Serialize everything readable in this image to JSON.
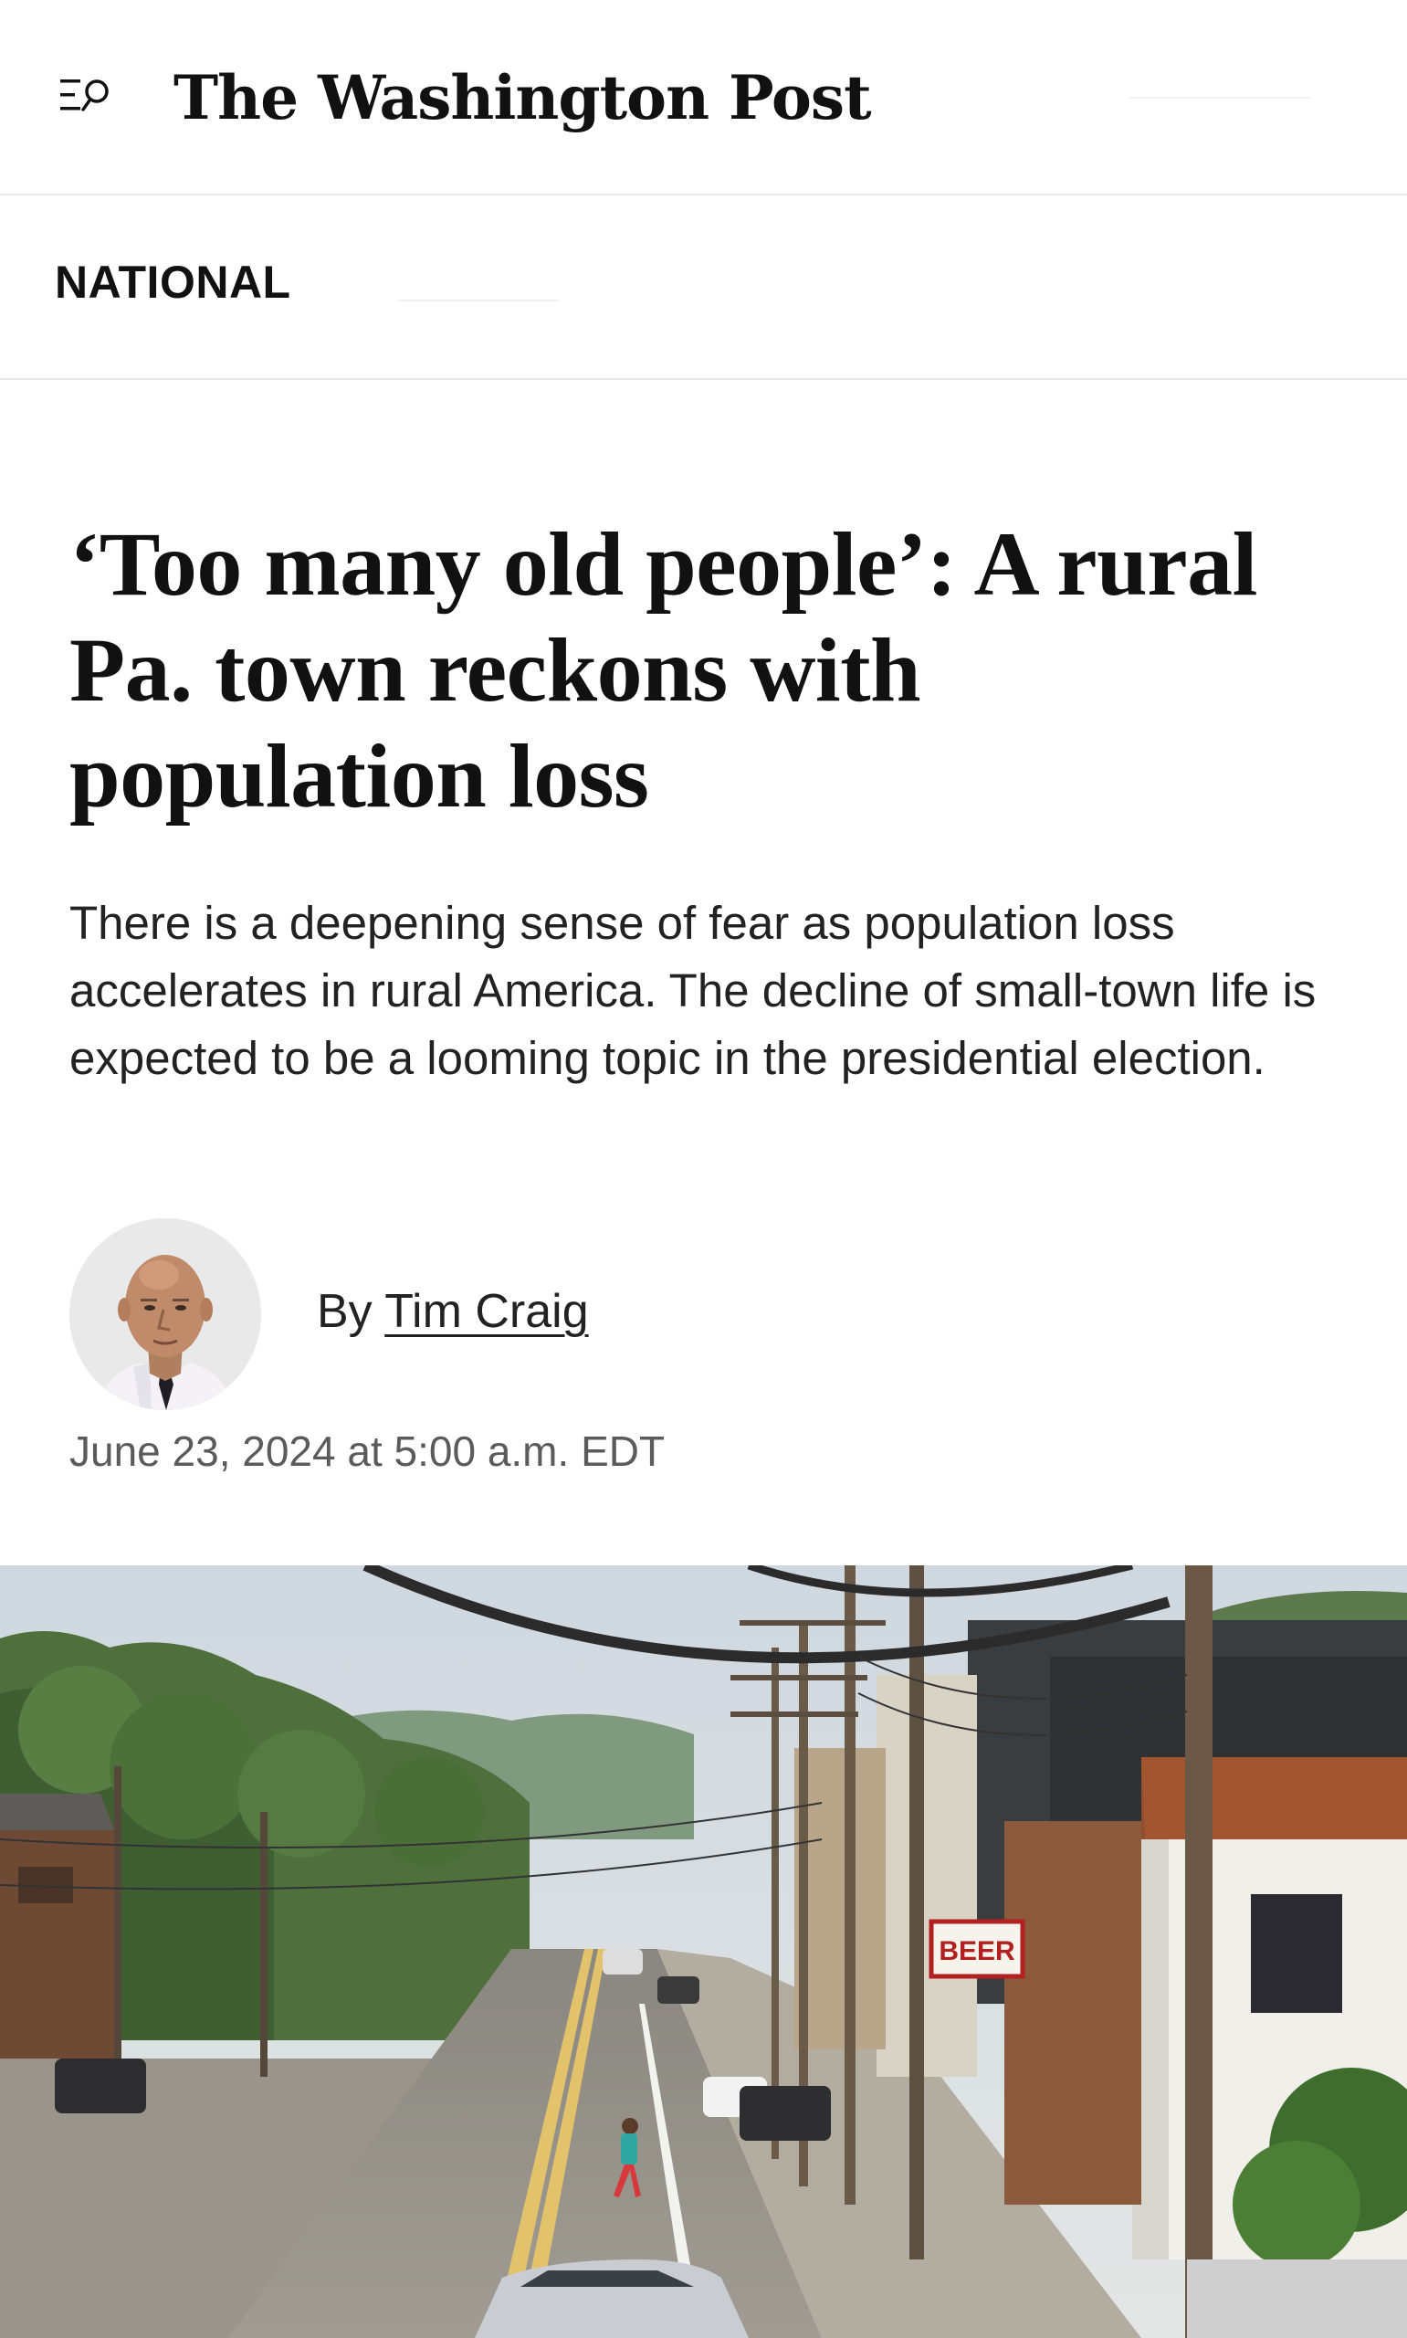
{
  "header": {
    "logo_text": "The Washington Post",
    "menu_icon": "menu-search-icon"
  },
  "section": {
    "label": "NATIONAL"
  },
  "article": {
    "headline": "‘Too many old people’: A rural Pa. town reckons with population loss",
    "dek": "There is a deepening sense of fear as population loss accelerates in rural America. The decline of small-town life is expected to be a looming topic in the presidential election.",
    "byline_prefix": "By ",
    "author": "Tim Craig",
    "timestamp": "June 23, 2024 at 5:00 a.m. EDT"
  },
  "photo": {
    "sign_text": "BEER"
  },
  "colors": {
    "text": "#111111",
    "secondary_text": "#5b5b5b",
    "divider": "#e8e8e8",
    "background": "#ffffff"
  }
}
